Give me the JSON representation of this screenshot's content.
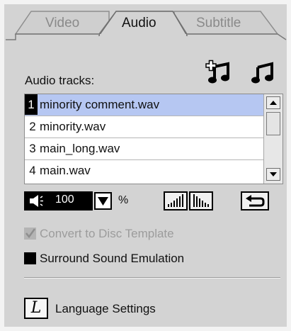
{
  "tabs": [
    {
      "label": "Video",
      "active": false
    },
    {
      "label": "Audio",
      "active": true
    },
    {
      "label": "Subtitle",
      "active": false
    }
  ],
  "audio_tracks": {
    "label": "Audio tracks:",
    "add_icon": "add-music-track-icon",
    "music_icon": "music-note-icon",
    "items": [
      {
        "number": "1",
        "name": "minority comment.wav",
        "selected": true
      },
      {
        "number": "2",
        "name": "minority.wav",
        "selected": false
      },
      {
        "number": "3",
        "name": "main_long.wav",
        "selected": false
      },
      {
        "number": "4",
        "name": "main.wav",
        "selected": false
      }
    ]
  },
  "volume": {
    "icon": "speaker-icon",
    "value": "100",
    "unit": "%",
    "eq_rising_icon": "volume-rising-icon",
    "eq_falling_icon": "volume-falling-icon",
    "reset_icon": "reset-arrow-icon"
  },
  "options": {
    "convert_label": "Convert to Disc Template",
    "convert_checked": true,
    "convert_disabled": true,
    "surround_label": "Surround Sound Emulation",
    "surround_checked": false
  },
  "language": {
    "icon_glyph": "L",
    "label": "Language Settings"
  },
  "colors": {
    "panel": "#d3d3d3",
    "selected_row": "#b6c7f2",
    "disabled_text": "#9c9c9c"
  }
}
